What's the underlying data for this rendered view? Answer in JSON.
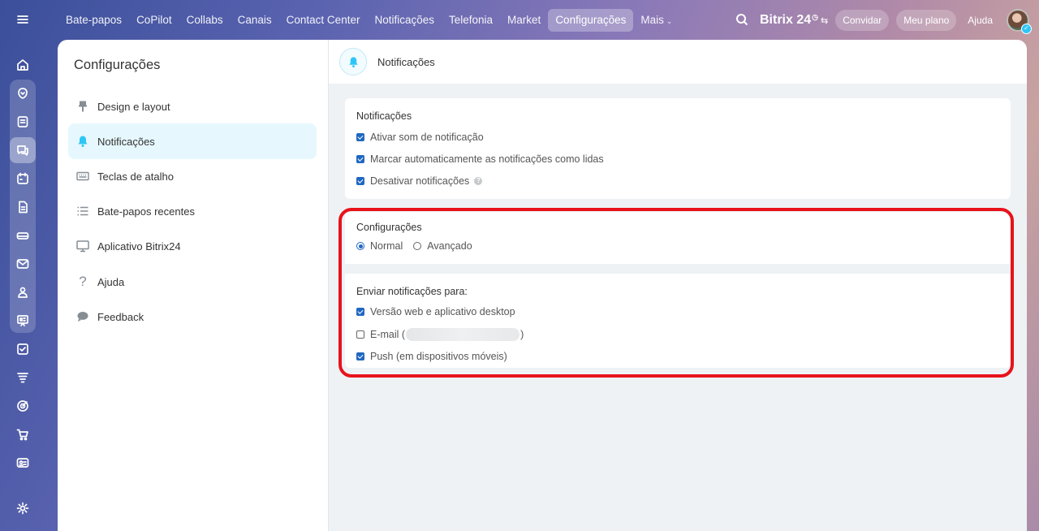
{
  "colors": {
    "accent": "#2067c2",
    "highlight": "#e8121b",
    "active_item_bg": "#e6f8fd",
    "bell": "#2fc6f6"
  },
  "rail": {
    "items": [
      {
        "name": "menu-icon"
      },
      {
        "name": "home-icon"
      },
      {
        "name": "copilot-icon"
      },
      {
        "name": "feed-icon"
      },
      {
        "name": "chat-icon"
      },
      {
        "name": "calendar-icon"
      },
      {
        "name": "documents-icon"
      },
      {
        "name": "drive-icon"
      },
      {
        "name": "mail-icon"
      },
      {
        "name": "groups-icon"
      },
      {
        "name": "board-icon"
      },
      {
        "name": "tasks-icon"
      },
      {
        "name": "crm-funnel-icon"
      },
      {
        "name": "marketing-icon"
      },
      {
        "name": "shop-cart-icon"
      },
      {
        "name": "contact-card-icon"
      },
      {
        "name": "settings-gear-icon"
      }
    ]
  },
  "topnav": {
    "items": [
      "Bate-papos",
      "CoPilot",
      "Collabs",
      "Canais",
      "Contact Center",
      "Notificações",
      "Telefonia",
      "Market",
      "Configurações"
    ],
    "more_label": "Mais",
    "active": "Configurações"
  },
  "topright": {
    "brand": "Bitrix 24",
    "invite": "Convidar",
    "plan": "Meu plano",
    "help": "Ajuda"
  },
  "sidebar": {
    "title": "Configurações",
    "items": [
      {
        "label": "Design e layout",
        "icon": "paint-roller-icon"
      },
      {
        "label": "Notificações",
        "icon": "bell-icon",
        "active": true
      },
      {
        "label": "Teclas de atalho",
        "icon": "keyboard-icon"
      },
      {
        "label": "Bate-papos recentes",
        "icon": "list-icon"
      },
      {
        "label": "Aplicativo Bitrix24",
        "icon": "monitor-icon"
      },
      {
        "label": "Ajuda",
        "icon": "question-icon"
      },
      {
        "label": "Feedback",
        "icon": "speech-bubble-icon"
      }
    ]
  },
  "main": {
    "title": "Notificações",
    "notifications": {
      "title": "Notificações",
      "options": [
        {
          "label": "Ativar som de notificação",
          "checked": true
        },
        {
          "label": "Marcar automaticamente as notificações como lidas",
          "checked": true
        },
        {
          "label": "Desativar notificações",
          "checked": true,
          "help": "?"
        }
      ]
    },
    "config": {
      "title": "Configurações",
      "modes": [
        {
          "label": "Normal",
          "selected": true
        },
        {
          "label": "Avançado",
          "selected": false
        }
      ]
    },
    "send_to": {
      "title": "Enviar notificações para:",
      "options": [
        {
          "label": "Versão web e aplicativo desktop",
          "checked": true
        },
        {
          "label_prefix": "E-mail (",
          "label_suffix": ")",
          "checked": false
        },
        {
          "label": "Push (em dispositivos móveis)",
          "checked": true
        }
      ]
    }
  }
}
